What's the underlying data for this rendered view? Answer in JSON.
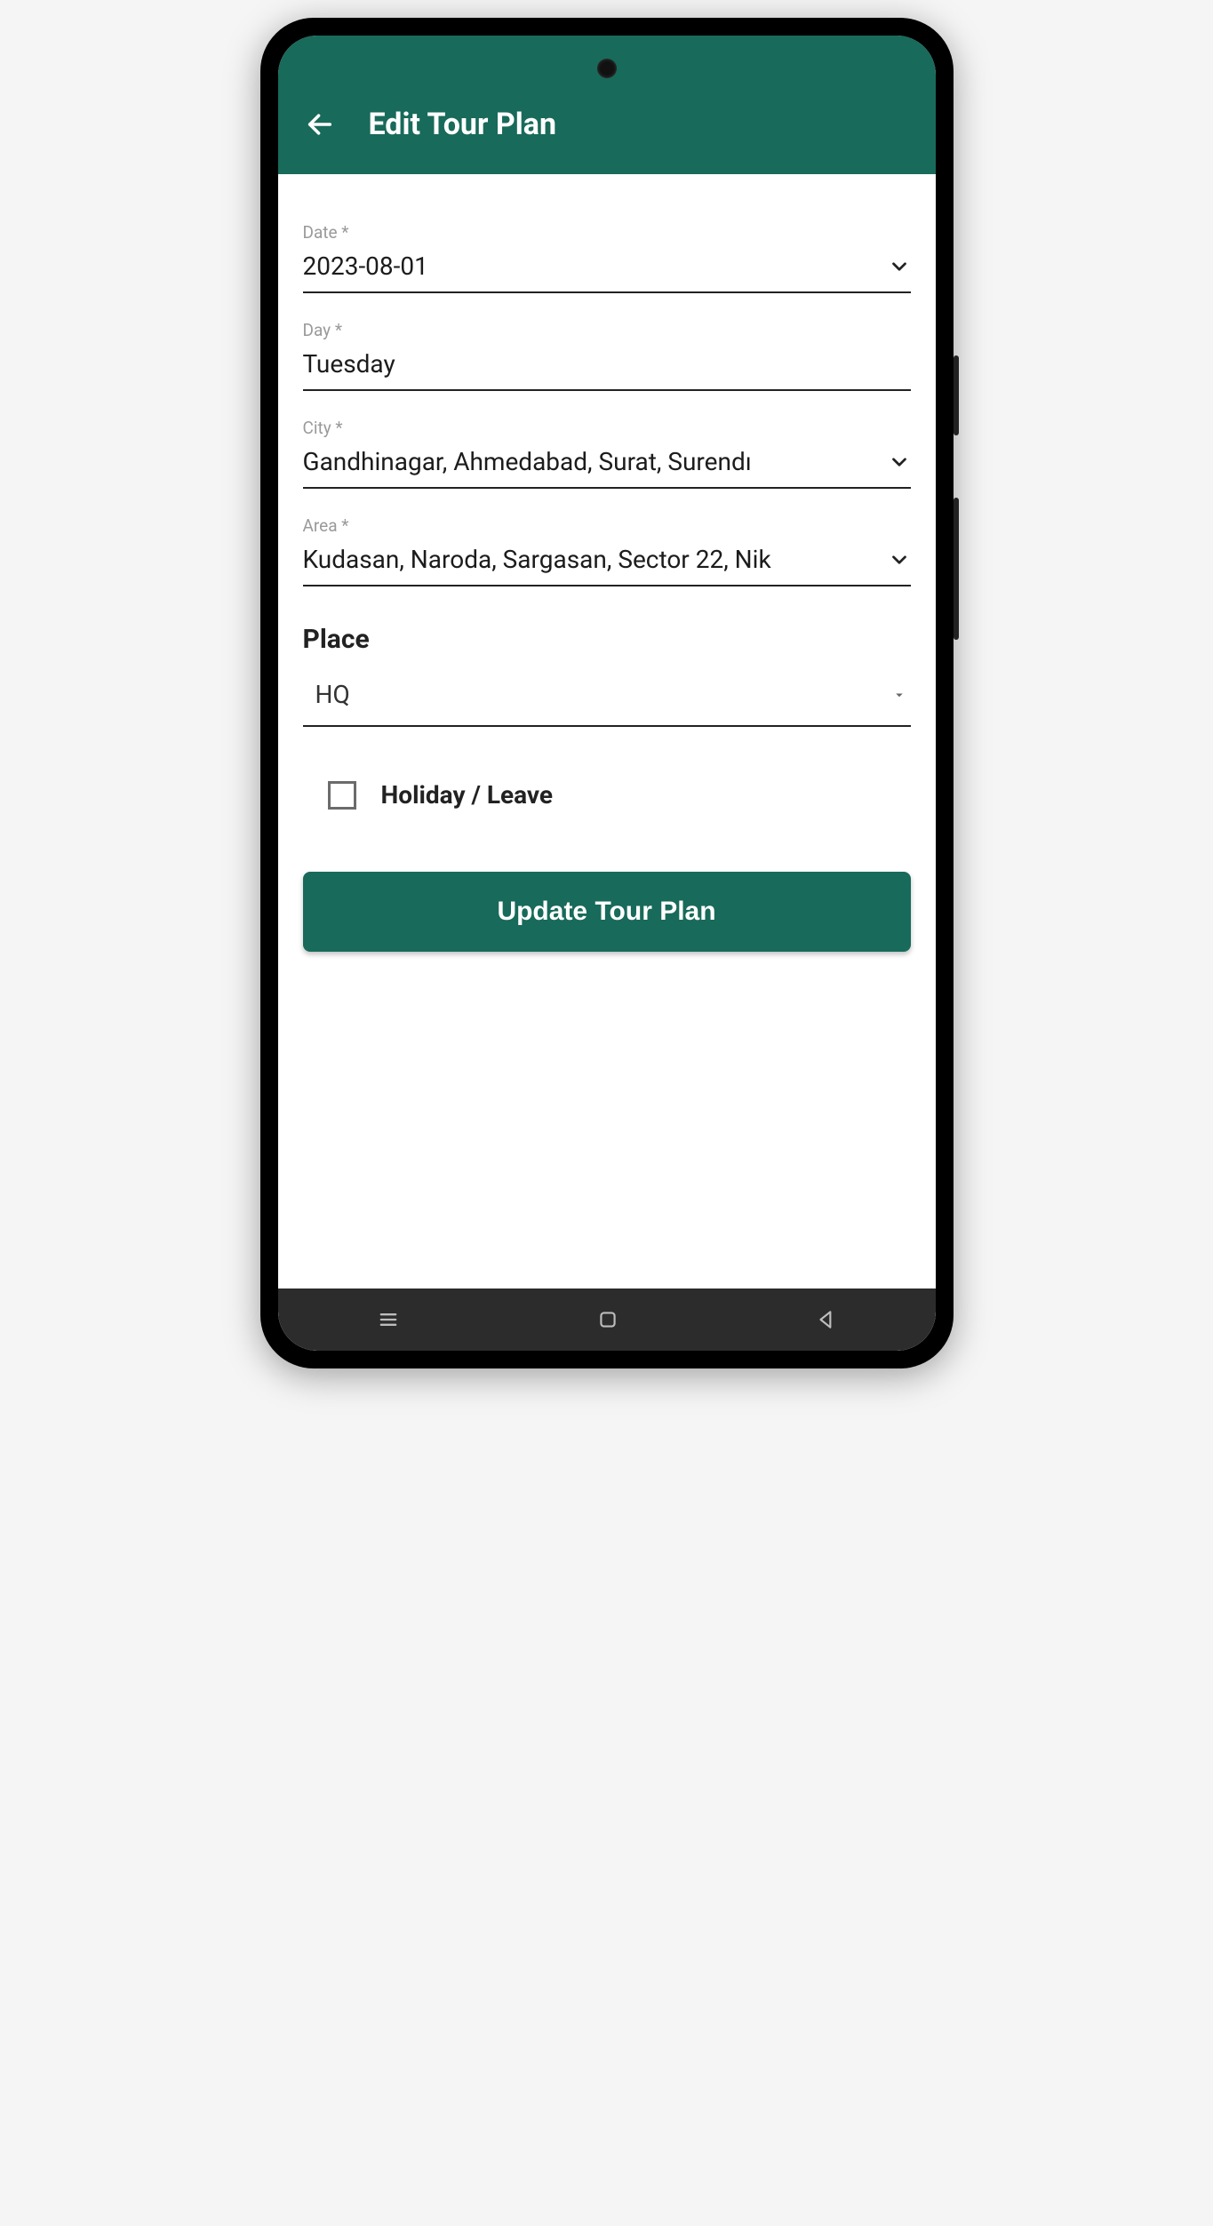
{
  "header": {
    "title": "Edit Tour Plan"
  },
  "form": {
    "date": {
      "label": "Date *",
      "value": "2023-08-01"
    },
    "day": {
      "label": "Day *",
      "value": "Tuesday"
    },
    "city": {
      "label": "City *",
      "value": "Gandhinagar, Ahmedabad, Surat, Surendı"
    },
    "area": {
      "label": "Area *",
      "value": "Kudasan, Naroda, Sargasan, Sector 22, Nik"
    },
    "place_section": "Place",
    "place": {
      "value": "HQ"
    },
    "holiday": {
      "label": "Holiday / Leave",
      "checked": false
    },
    "submit": "Update Tour Plan"
  }
}
